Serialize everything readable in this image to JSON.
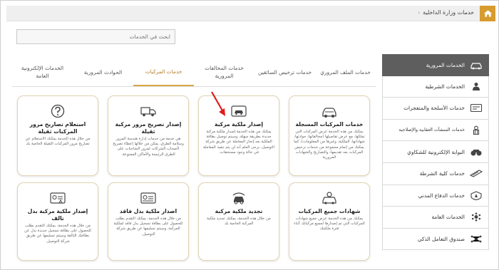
{
  "header": {
    "breadcrumb": "خدمات وزارة الداخلية",
    "home_icon": "home-icon",
    "accent": "#d79b2e"
  },
  "search": {
    "placeholder": "ابحث في الخدمات"
  },
  "sidebar": {
    "items": [
      {
        "label": "الخدمات المرورية",
        "icon": "car-icon",
        "active": true
      },
      {
        "label": "الخدمات الشرطية",
        "icon": "police-icon",
        "active": false
      },
      {
        "label": "خدمات الأسلحة والمتفجرات",
        "icon": "weapon-license-icon",
        "active": false
      },
      {
        "label": "خدمات المنشآت العقابية والإصلاحية",
        "icon": "prisoner-icon",
        "active": false
      },
      {
        "label": "البوابة الإلكترونية للشكاوي",
        "icon": "complaints-icon",
        "active": false
      },
      {
        "label": "خدمات كلية الشرطة",
        "icon": "academy-icon",
        "active": false
      },
      {
        "label": "خدمات الدفاع المدني",
        "icon": "civil-defense-icon",
        "active": false
      },
      {
        "label": "الخدمات العامة",
        "icon": "general-services-icon",
        "active": false
      },
      {
        "label": "صندوق التعامل الذكي",
        "icon": "smart-box-icon",
        "active": false
      }
    ]
  },
  "tabs": [
    {
      "label": "خدمات الملف المروري",
      "active": false
    },
    {
      "label": "خدمات ترخيص السائقين",
      "active": false
    },
    {
      "label": "خدمات المخالفات المرورية",
      "active": false
    },
    {
      "label": "خدمات المركبات",
      "active": true
    },
    {
      "label": "الحوادث المرورية",
      "active": false
    },
    {
      "label": "الخدمات الإلكترونية العامة",
      "active": false
    }
  ],
  "cards": [
    {
      "title": "خدمات المركبات المسجلة",
      "desc": "يمكنك من هذه الخدمة عرض المركبات التي تملكها، مع عرض تفاصيلها (مخالفاتها، حوادثها، شهاداتها، الملكية، وغيرها من المعلومات)، كما يمكنك من إتمام مجموعة من خدمات ترخيص المركبات بعد تقديمها، والتصاريح والشهادات المرورية",
      "icon": "registered-cars-icon"
    },
    {
      "title": "إصدار ملكية مركبة",
      "desc": "يمكنك من هذه الخدمة إصدار ملكية مركبة جديدة بطريقة سهلة، وسيتم توصيل بطاقة الملكية بعد إنجاز المعاملة عن طريق شركة التوصيل، يرجى العلم أنه لن يتم تنفيذ المعاملة في حالة وجود مستحقات.",
      "icon": "car-ownership-icon"
    },
    {
      "title": "إصدار تصريح مرور مركبة ثقيلة",
      "desc": "هي خدمة من خدمات إدارة هندسة المرور وسلامة الطرق، يمكن من خلالها إعطاء تصريح لأصحاب الشركات لمرور الشاحنات على الطرق الرئيسة والأماكن الممنوعة.",
      "icon": "heavy-vehicle-icon"
    },
    {
      "title": "استعلام تصاريح مرور المركبات ثقيلة",
      "desc": "من خلال هذه الخدمة يمكنك الاستعلام عن تصاريح مرور المركبات الثقيلة الخاصة بك",
      "icon": "question-icon"
    },
    {
      "title": "شهادات جميع المركبات",
      "desc": "يمكنك من هذه الخدمة عرض جميع شهادات المركبات التي تم إصدارها لجميع مركباتك أثناء فترة ملكيتك",
      "icon": "certificate-icon"
    },
    {
      "title": "تجديد ملكية مركبة",
      "desc": "من خلال هذه الخدمة، يمكنك تجديد ملكية المركبة الخاصة بك",
      "icon": "renew-icon"
    },
    {
      "title": "اصدار ملكية بدل فاقد",
      "desc": "من خلال هذه الخدمة، يمكنك التقدم بطلب للحصول على بطاقة تسجيل بدل فاقد لملكية المركبة، وسيتم تسليمها عن طريق شركة التوصيل.",
      "icon": "lost-card-icon"
    },
    {
      "title": "إصدار ملكية مركبة بدل تالف",
      "desc": "من خلال هذه الخدمة، يمكنك التقدم بطلب للحصول على بطاقة تسجيل جديدة بدل عن بطاقتك التالفة وسيتم تسليمها عن طريق شركة التوصيل.",
      "icon": "damaged-card-icon"
    }
  ]
}
